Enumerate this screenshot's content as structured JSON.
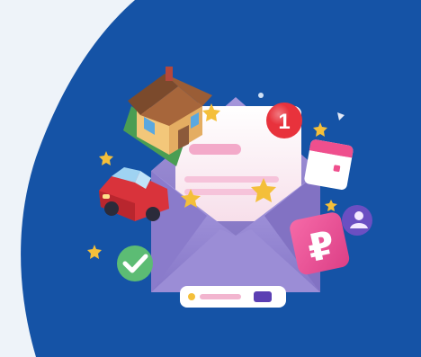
{
  "colors": {
    "background_light": "#eef3f9",
    "background_blue": "#1553a6",
    "envelope": "#8f7fcb",
    "envelope_dark": "#7466b8",
    "letter_paper": "#fdf1f5",
    "notification_red": "#e8323c",
    "ruble_tag": "#ee4f95",
    "check_green": "#5cbc74",
    "car_red": "#d9333b",
    "star": "#f4bf3a"
  },
  "notification": {
    "count": "1"
  },
  "tag": {
    "currency_symbol": "₽"
  },
  "icons": {
    "house": "house-icon",
    "car": "car-icon",
    "calendar": "calendar-icon",
    "profile": "profile-icon",
    "check": "checkmark-icon",
    "envelope": "open-envelope-icon",
    "star": "star-icon",
    "toggle": "toggle-card-icon"
  }
}
